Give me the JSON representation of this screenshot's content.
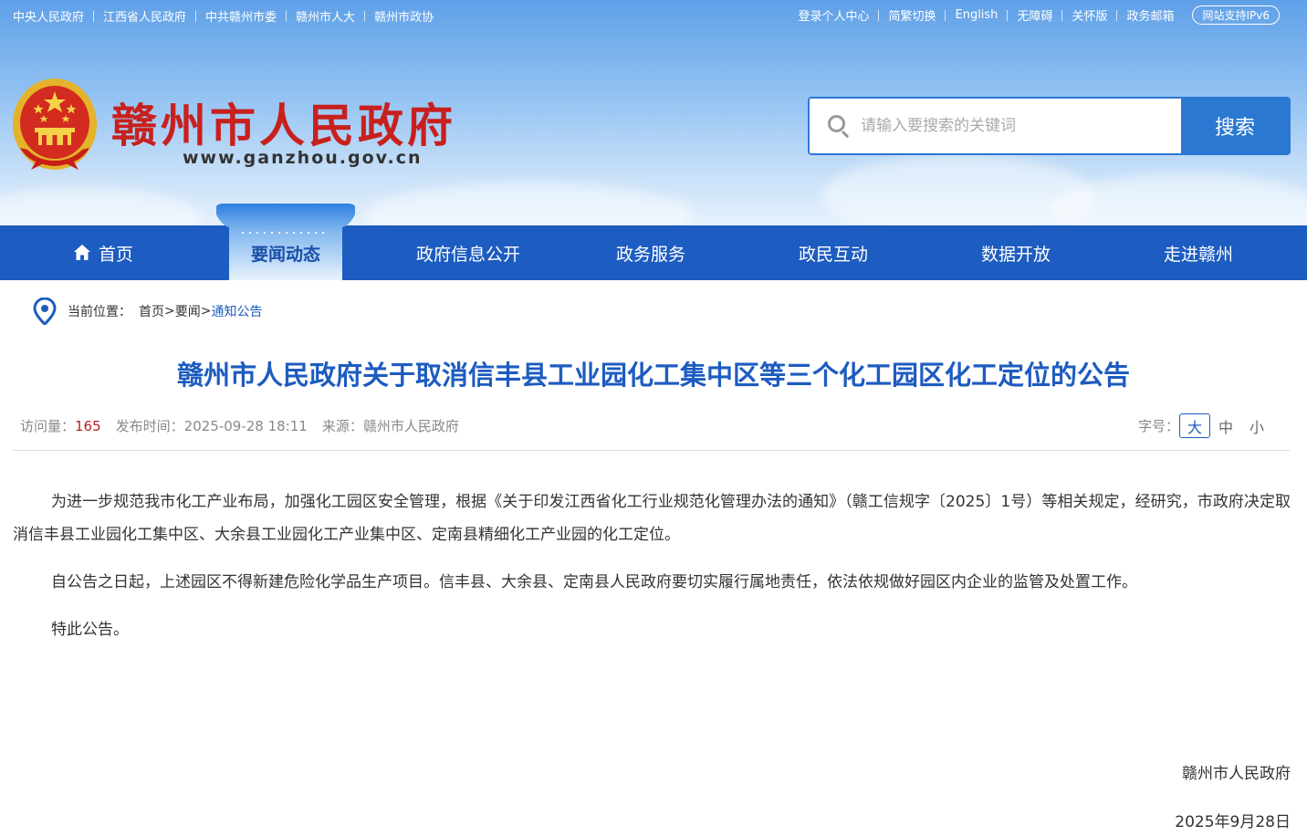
{
  "topbar": {
    "left_links": [
      "中央人民政府",
      "江西省人民政府",
      "中共赣州市委",
      "赣州市人大",
      "赣州市政协"
    ],
    "right_links": [
      "登录个人中心",
      "简繁切换",
      "English",
      "无障碍",
      "关怀版",
      "政务邮箱"
    ],
    "ipv6": "网站支持IPv6"
  },
  "logo": {
    "icon": "national-emblem-icon",
    "site_name": "赣州市人民政府",
    "site_url": "www.ganzhou.gov.cn"
  },
  "search": {
    "placeholder": "请输入要搜索的关键词",
    "value": "",
    "button_label": "搜索",
    "icon": "search-icon"
  },
  "nav": {
    "items": [
      {
        "label": "首页",
        "icon": "home-icon"
      },
      {
        "label": "要闻动态",
        "active": true
      },
      {
        "label": "政府信息公开"
      },
      {
        "label": "政务服务"
      },
      {
        "label": "政民互动"
      },
      {
        "label": "数据开放"
      },
      {
        "label": "走进赣州"
      }
    ]
  },
  "breadcrumb": {
    "icon": "location-pin-icon",
    "prefix": "当前位置：",
    "items": [
      "首页",
      "要闻",
      "通知公告"
    ],
    "separator": ">"
  },
  "article": {
    "title": "赣州市人民政府关于取消信丰县工业园化工集中区等三个化工园区化工定位的公告",
    "meta": {
      "visits_label": "访问量：",
      "visits": "165",
      "date_label": "发布时间：",
      "date": "2025-09-28 18:11",
      "source_label": "来源：",
      "source": "赣州市人民政府"
    },
    "font_size": {
      "label": "字号：",
      "options": [
        "大",
        "中",
        "小"
      ],
      "selected": "大"
    },
    "paragraphs": [
      "为进一步规范我市化工产业布局，加强化工园区安全管理，根据《关于印发江西省化工行业规范化管理办法的通知》（赣工信规字〔2025〕1号）等相关规定，经研究，市政府决定取消信丰县工业园化工集中区、大余县工业园化工产业集中区、定南县精细化工产业园的化工定位。",
      "自公告之日起，上述园区不得新建危险化学品生产项目。信丰县、大余县、定南县人民政府要切实履行属地责任，依法依规做好园区内企业的监管及处置工作。",
      "特此公告。"
    ],
    "signature": "赣州市人民政府",
    "sign_date": "2025年9月28日"
  },
  "colors": {
    "nav_blue": "#1d5cc0",
    "title_blue": "#1d5cc0",
    "site_red": "#c8201d",
    "visits_red": "#b22222"
  }
}
